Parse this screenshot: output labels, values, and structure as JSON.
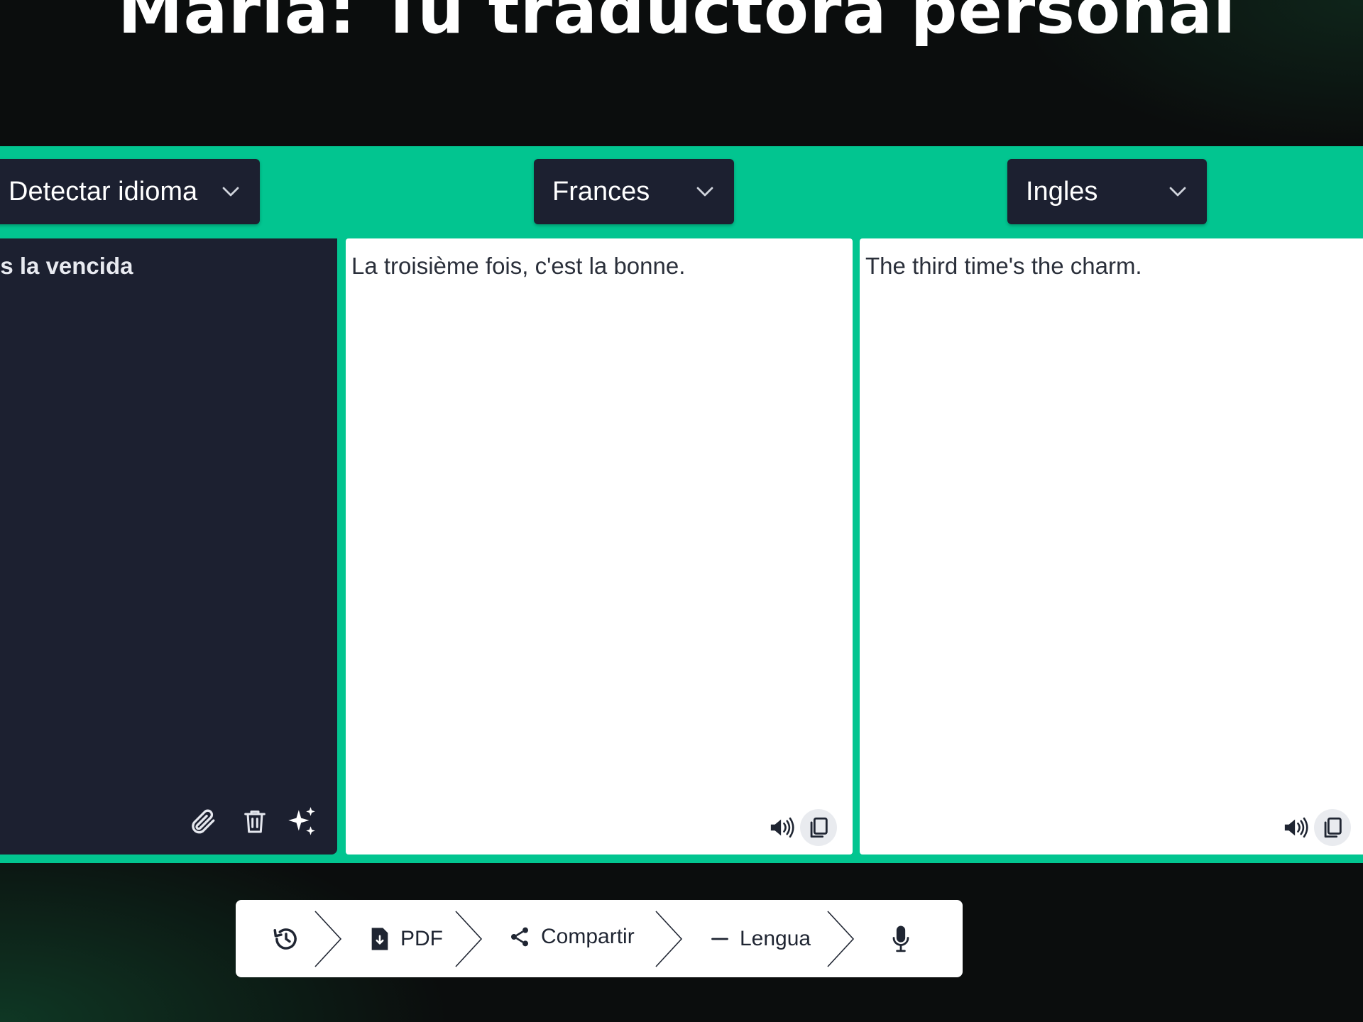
{
  "app": {
    "title": "Maria: Tu traductora personal"
  },
  "languages": {
    "source": "Detectar idioma",
    "target1": "Frances",
    "target2": "Ingles"
  },
  "panels": {
    "source_text": "es la vencida",
    "french_text": "La troisième fois, c'est la bonne.",
    "english_text": "The third time's the charm."
  },
  "toolbar": {
    "pdf_label": "PDF",
    "share_label": "Compartir",
    "language_label": "Lengua"
  },
  "icons": {
    "source_actions": [
      "paperclip-icon",
      "trash-icon",
      "sparkles-icon"
    ],
    "output_actions": [
      "speaker-icon",
      "copy-icon"
    ],
    "toolbar": [
      "history-icon",
      "pdf-file-icon",
      "share-icon",
      "minus-icon",
      "microphone-icon"
    ]
  },
  "colors": {
    "accent": "#02c590",
    "panel_dark": "#1c2030",
    "background": "#0b0d0d"
  }
}
